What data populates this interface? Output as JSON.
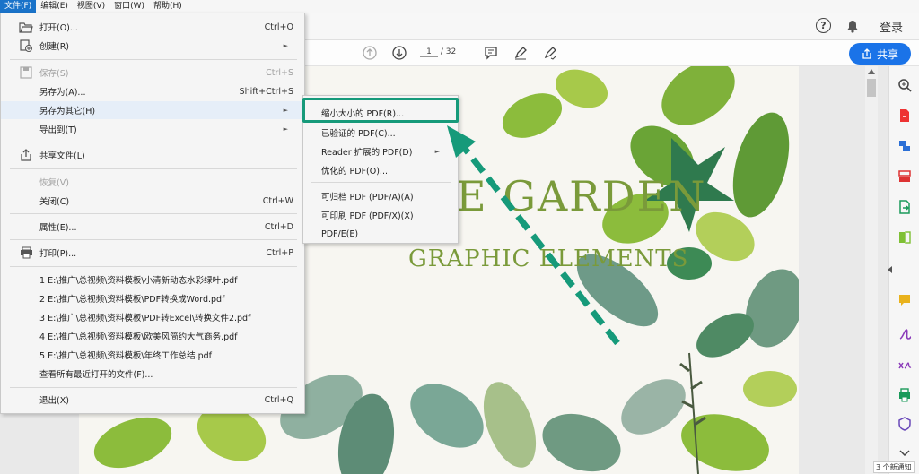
{
  "menubar": {
    "items": [
      "文件(F)",
      "编辑(E)",
      "视图(V)",
      "窗口(W)",
      "帮助(H)"
    ]
  },
  "appbar": {
    "login": "登录"
  },
  "toolbar": {
    "page_current": "1",
    "page_total": "/ 32",
    "share_label": "共享"
  },
  "file_menu": {
    "open": {
      "label": "打开(O)...",
      "shortcut": "Ctrl+O"
    },
    "create": {
      "label": "创建(R)"
    },
    "save": {
      "label": "保存(S)",
      "shortcut": "Ctrl+S"
    },
    "save_as": {
      "label": "另存为(A)...",
      "shortcut": "Shift+Ctrl+S"
    },
    "save_as_other": {
      "label": "另存为其它(H)"
    },
    "export": {
      "label": "导出到(T)"
    },
    "share_file": {
      "label": "共享文件(L)"
    },
    "revert": {
      "label": "恢复(V)"
    },
    "close": {
      "label": "关闭(C)",
      "shortcut": "Ctrl+W"
    },
    "properties": {
      "label": "属性(E)...",
      "shortcut": "Ctrl+D"
    },
    "print": {
      "label": "打印(P)...",
      "shortcut": "Ctrl+P"
    },
    "recent": [
      "1 E:\\推广\\总视频\\资料模板\\小清新动态水彩绿叶.pdf",
      "2 E:\\推广\\总视频\\资料模板\\PDF转换成Word.pdf",
      "3 E:\\推广\\总视频\\资料模板\\PDF转Excel\\转换文件2.pdf",
      "4 E:\\推广\\总视频\\资料模板\\欧美风简约大气商务.pdf",
      "5 E:\\推广\\总视频\\资料模板\\年终工作总结.pdf"
    ],
    "view_all_recent": {
      "label": "查看所有最近打开的文件(F)..."
    },
    "exit": {
      "label": "退出(X)",
      "shortcut": "Ctrl+Q"
    }
  },
  "submenu": {
    "items": [
      "缩小大小的 PDF(R)...",
      "已验证的 PDF(C)...",
      "Reader 扩展的 PDF(D)",
      "优化的 PDF(O)...",
      "可归档 PDF (PDF/A)(A)",
      "可印刷 PDF (PDF/X)(X)",
      "PDF/E(E)"
    ]
  },
  "document": {
    "title_fragment": "E GARDEN",
    "subtitle": "GRAPHIC ELEMENTS"
  },
  "notification": "3 个新通知",
  "colors": {
    "accent": "#1a73e8",
    "highlight_box": "#169a7a",
    "title_green": "#7a9a3a"
  }
}
